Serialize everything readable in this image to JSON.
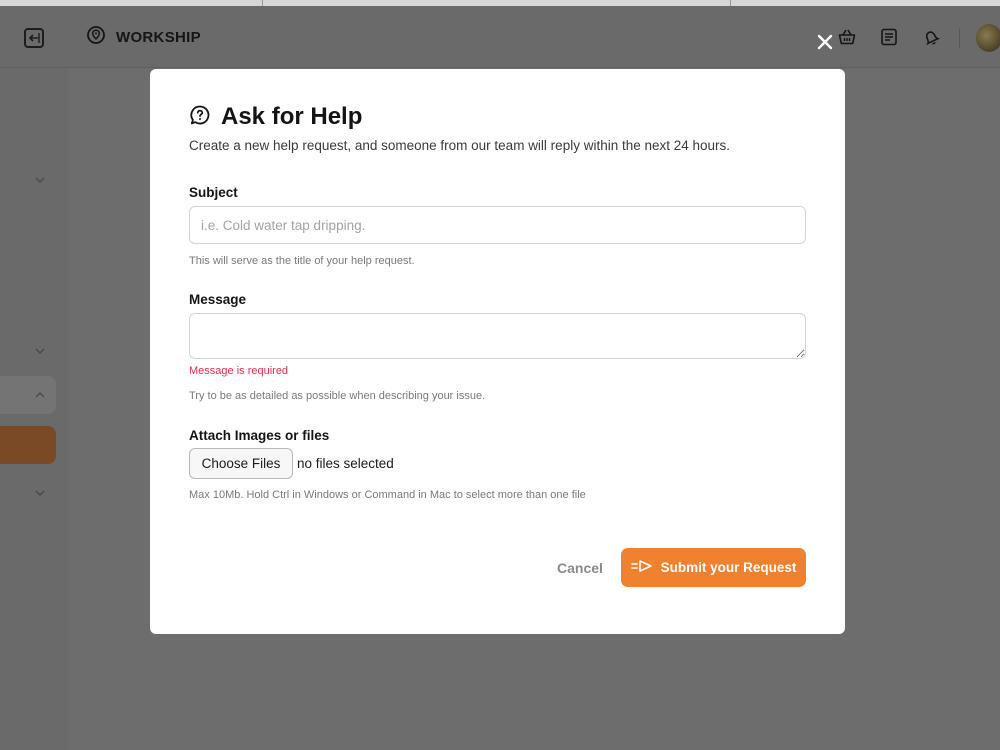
{
  "header": {
    "brand": "WORKSHIP",
    "icons": [
      "sidebar-collapse-icon",
      "location-icon",
      "basket-icon",
      "notepad-icon",
      "bell-icon",
      "avatar"
    ]
  },
  "modal": {
    "close_icon": "close-icon",
    "title": "Ask for Help",
    "description": "Create a new help request, and someone from our team will reply within the next 24 hours.",
    "subject": {
      "label": "Subject",
      "value": "",
      "placeholder": "i.e. Cold water tap dripping.",
      "hint": "This will serve as the title of your help request."
    },
    "message": {
      "label": "Message",
      "value": "",
      "error": "Message is required",
      "hint": "Try to be as detailed as possible when describing your issue."
    },
    "attachments": {
      "label": "Attach Images or files",
      "button_label": "Choose Files",
      "status": "no files selected",
      "hint": "Max 10Mb. Hold Ctrl in Windows or Command in Mac to select more than one file"
    },
    "actions": {
      "cancel_label": "Cancel",
      "submit_label": "Submit your Request"
    }
  },
  "colors": {
    "accent": "#f0812e",
    "error": "#e0304b",
    "overlay": "#696969"
  }
}
